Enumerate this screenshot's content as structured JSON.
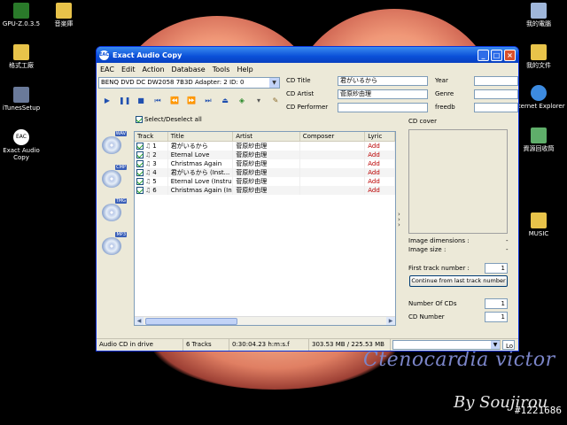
{
  "desktop": {
    "icons": [
      {
        "label": "GPU-Z.0.3.5"
      },
      {
        "label": "音楽庫"
      },
      {
        "label": "格式工廠"
      },
      {
        "label": "iTunesSetup"
      },
      {
        "label": "Exact Audio Copy"
      },
      {
        "label": "我的電腦"
      },
      {
        "label": "我的文件"
      },
      {
        "label": "Internet Explorer"
      },
      {
        "label": "資源回收筒"
      },
      {
        "label": "MUSIC"
      }
    ],
    "wallpaper_caption": "Ctenocardia victor",
    "wallpaper_signature": "By Soujirou",
    "image_id": "#1221686"
  },
  "window": {
    "app_icon": "EAC",
    "title": "Exact Audio Copy",
    "menu": [
      "EAC",
      "Edit",
      "Action",
      "Database",
      "Tools",
      "Help"
    ],
    "drive": "BENQ    DVD DC DW2058 7B3D   Adapter: 2  ID: 0",
    "select_all_label": "Select/Deselect all",
    "cd_info": {
      "title_label": "CD Title",
      "title_value": "君がいるから",
      "artist_label": "CD Artist",
      "artist_value": "菅原紗由理",
      "performer_label": "CD Performer",
      "performer_value": "",
      "year_label": "Year",
      "genre_label": "Genre",
      "freedb_label": "freedb"
    },
    "side_tags": [
      "WAV",
      "CMP",
      "TMG",
      "MP3"
    ],
    "tracks": {
      "columns": [
        "Track",
        "Title",
        "Artist",
        "Composer",
        "Lyric"
      ],
      "rows": [
        {
          "num": "1",
          "title": "君がいるから",
          "artist": "菅原紗由理",
          "composer": "",
          "lyric": "Add"
        },
        {
          "num": "2",
          "title": "Eternal Love",
          "artist": "菅原紗由理",
          "composer": "",
          "lyric": "Add"
        },
        {
          "num": "3",
          "title": "Christmas Again",
          "artist": "菅原紗由理",
          "composer": "",
          "lyric": "Add"
        },
        {
          "num": "4",
          "title": "君がいるから (Inst...",
          "artist": "菅原紗由理",
          "composer": "",
          "lyric": "Add"
        },
        {
          "num": "5",
          "title": "Eternal Love (Instru...",
          "artist": "菅原紗由理",
          "composer": "",
          "lyric": "Add"
        },
        {
          "num": "6",
          "title": "Christmas Again (Ins...",
          "artist": "菅原紗由理",
          "composer": "",
          "lyric": "Add"
        }
      ]
    },
    "right_pane": {
      "cover_label": "CD cover",
      "image_dimensions_label": "Image dimensions :",
      "image_dimensions_value": "-",
      "image_size_label": "Image size :",
      "image_size_value": "-",
      "first_track_label": "First track number :",
      "first_track_value": "1",
      "continue_button": "Continue from last track number",
      "num_cds_label": "Number Of CDs",
      "num_cds_value": "1",
      "cd_number_label": "CD Number",
      "cd_number_value": "1"
    },
    "status": {
      "drive_status": "Audio CD in drive",
      "track_count": "6 Tracks",
      "length": "0:30:04.23 h:m:s.f",
      "size": "303.53 MB / 225.53 MB",
      "log_button": "Lo"
    }
  },
  "colors": {
    "title_bar": "#0a4fd8",
    "window_bg": "#ece9d8",
    "lyric_add": "#bb0000"
  }
}
